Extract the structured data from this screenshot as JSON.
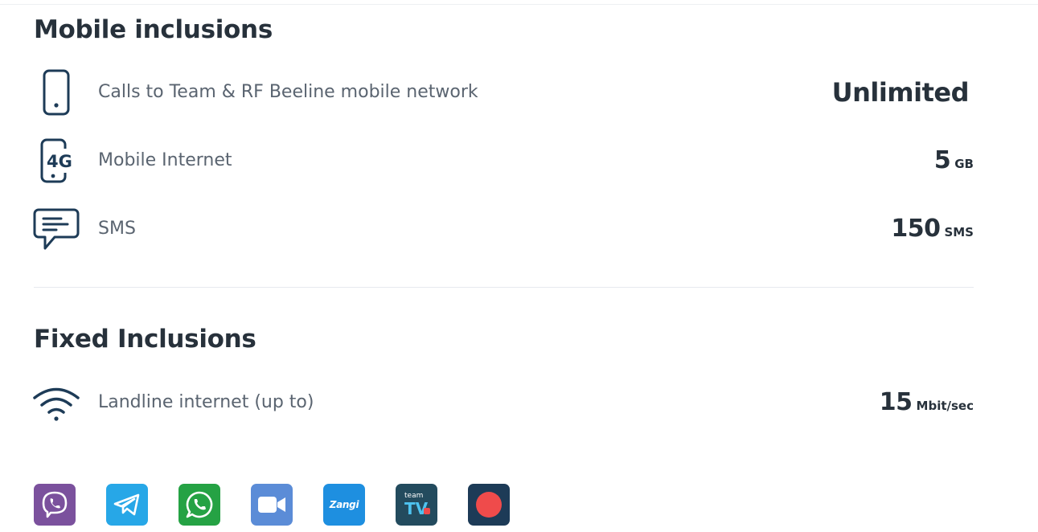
{
  "mobile": {
    "title": "Mobile inclusions",
    "items": [
      {
        "icon": "phone-icon",
        "label": "Calls to Team & RF Beeline mobile network",
        "value": "Unlimited",
        "unit": ""
      },
      {
        "icon": "4g-phone-icon",
        "label": "Mobile Internet",
        "value": "5",
        "unit": "GB"
      },
      {
        "icon": "sms-icon",
        "label": "SMS",
        "value": "150",
        "unit": "SMS"
      }
    ]
  },
  "fixed": {
    "title": "Fixed Inclusions",
    "items": [
      {
        "icon": "wifi-icon",
        "label": "Landline internet (up to)",
        "value": "15",
        "unit": "Mbit/sec"
      }
    ]
  },
  "icon_glyphs": {
    "four_g": "4G"
  },
  "apps": [
    {
      "name": "viber",
      "color": "#7b519d"
    },
    {
      "name": "telegram",
      "color": "#27a7e7"
    },
    {
      "name": "whatsapp",
      "color": "#25a244"
    },
    {
      "name": "zoom",
      "color": "#5b8cd7",
      "note": "video-camera-icon"
    },
    {
      "name": "zangi",
      "color": "#1e8fe0",
      "text": "Zangi"
    },
    {
      "name": "team-tv",
      "color": "#234b5e",
      "text_top": "team",
      "text_main": "TV"
    },
    {
      "name": "recorder",
      "color": "#1d3b57"
    }
  ],
  "colors": {
    "heading": "#27313b",
    "label": "#5a6470",
    "icon": "#1d3b57"
  }
}
